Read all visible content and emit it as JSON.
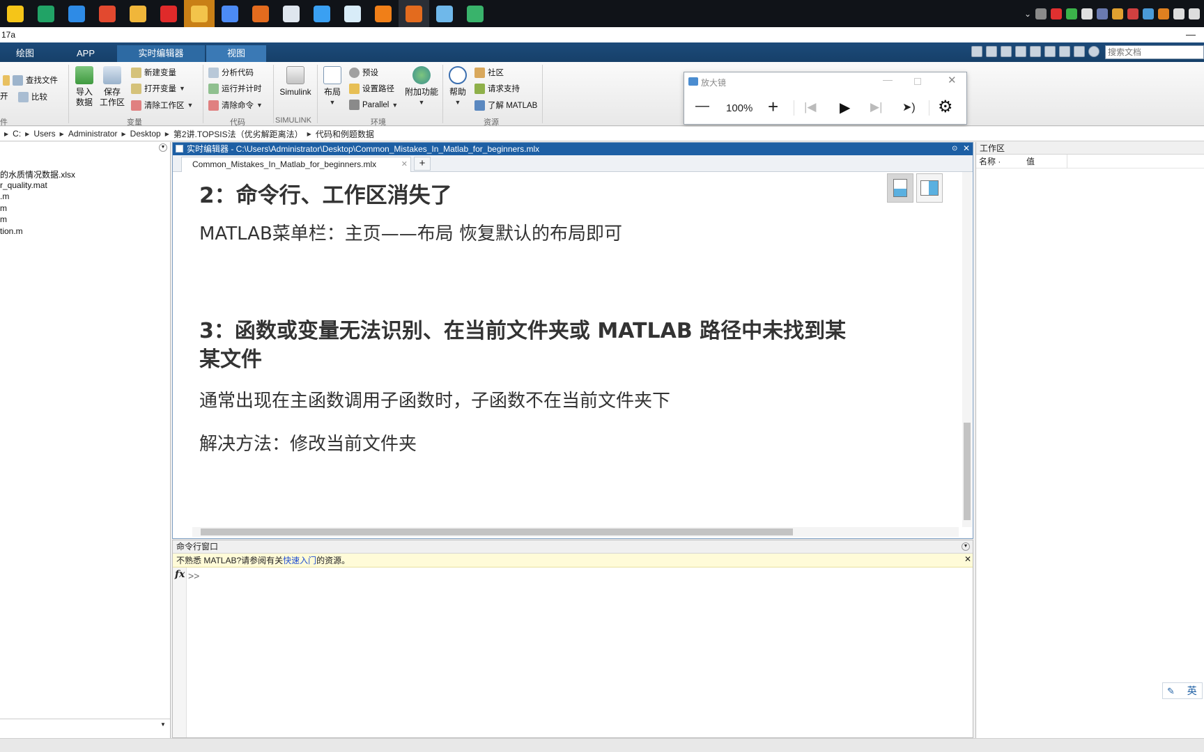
{
  "taskbar": {
    "apps": [
      {
        "name": "sticky-notes-app-icon",
        "color": "#f5c518",
        "state": ""
      },
      {
        "name": "excel-app-icon",
        "color": "#21a366",
        "state": ""
      },
      {
        "name": "sogou-app-icon",
        "color": "#2e8be6",
        "state": ""
      },
      {
        "name": "listen-app-icon",
        "color": "#e2492f",
        "state": ""
      },
      {
        "name": "file-explorer-app-icon",
        "color": "#f0b63a",
        "state": ""
      },
      {
        "name": "netease-music-app-icon",
        "color": "#e02a2a",
        "state": ""
      },
      {
        "name": "folder-app-icon",
        "color": "#f3c44b",
        "state": "active"
      },
      {
        "name": "chrome-app-icon",
        "color": "#4c8bf5",
        "state": ""
      },
      {
        "name": "matlab-app-icon",
        "color": "#e36b1e",
        "state": ""
      },
      {
        "name": "document-app-icon",
        "color": "#dfe6ee",
        "state": ""
      },
      {
        "name": "baidu-netdisk-app-icon",
        "color": "#3aa0f2",
        "state": ""
      },
      {
        "name": "pdf-viewer-app-icon",
        "color": "#d8ecf8",
        "state": ""
      },
      {
        "name": "search-app-icon",
        "color": "#f07f18",
        "state": ""
      },
      {
        "name": "matlab-running-app-icon",
        "color": "#e36b1e",
        "state": "dim"
      },
      {
        "name": "remote-desktop-app-icon",
        "color": "#6fb8ea",
        "state": ""
      },
      {
        "name": "screen-tool-app-icon",
        "color": "#39b36b",
        "state": ""
      }
    ],
    "tray": [
      "#8a8a8a",
      "#e03030",
      "#3bb34a",
      "#e0e0e0",
      "#6a7ab0",
      "#e0a030",
      "#d04040",
      "#4a9ad8",
      "#e08020",
      "#dddddd",
      "#dddddd"
    ]
  },
  "window": {
    "title": "17a",
    "minimize_glyph": "—"
  },
  "ribbon_tabs": [
    {
      "label": "绘图",
      "style": "normal"
    },
    {
      "label": "APP",
      "style": "normal"
    },
    {
      "label": "实时编辑器",
      "style": "selected"
    },
    {
      "label": "视图",
      "style": "hl"
    }
  ],
  "search_docs_placeholder": "搜索文档",
  "ribbon": {
    "file_group": {
      "find_files": "查找文件",
      "open": "开",
      "compare": "比较",
      "label": "件"
    },
    "import_data": "导入\n数据",
    "save_workspace": "保存\n工作区",
    "variable_group": {
      "new_variable": "新建变量",
      "open_variable": "打开变量",
      "clear_workspace": "清除工作区",
      "label": "变量"
    },
    "code_group": {
      "analyze_code": "分析代码",
      "run_and_time": "运行并计时",
      "clear_commands": "清除命令",
      "label": "代码"
    },
    "simulink": "Simulink",
    "simulink_label": "SIMULINK",
    "layout": "布局",
    "env_group": {
      "preferences": "预设",
      "set_path": "设置路径",
      "parallel": "Parallel",
      "label": "环境"
    },
    "addons": "附加功能",
    "help": "帮助",
    "resources_group": {
      "community": "社区",
      "request_support": "请求支持",
      "learn_matlab": "了解 MATLAB",
      "label": "资源"
    }
  },
  "magnifier": {
    "title": "放大镜",
    "zoom": "100%",
    "minus": "—",
    "plus": "+"
  },
  "address": {
    "crumbs": [
      "C:",
      "Users",
      "Administrator",
      "Desktop",
      "第2讲.TOPSIS法（优劣解距离法）",
      "代码和例题数据"
    ]
  },
  "files": [
    "的水质情况数据.xlsx",
    "r_quality.mat",
    ".m",
    "m",
    "m",
    "tion.m"
  ],
  "editor": {
    "title": "实时编辑器 - C:\\Users\\Administrator\\Desktop\\Common_Mistakes_In_Matlab_for_beginners.mlx",
    "tab": "Common_Mistakes_In_Matlab_for_beginners.mlx",
    "tab_close": "✕",
    "add_tab": "+",
    "heading2": "2：命令行、工作区消失了",
    "para1": "MATLAB菜单栏：主页——布局  恢复默认的布局即可",
    "heading3_line1": "3：函数或变量无法识别、在当前文件夹或 MATLAB 路径中未找到某",
    "heading3_line2": "某文件",
    "para2": "通常出现在主函数调用子函数时，子函数不在当前文件夹下",
    "para3": "解决方法：修改当前文件夹"
  },
  "command_window": {
    "header": "命令行窗口",
    "banner_prefix": "不熟悉 MATLAB?请参阅有关",
    "banner_link": "快速入门",
    "banner_suffix": "的资源。",
    "prompt": ">>"
  },
  "workspace": {
    "header": "工作区",
    "col_name": "名称 ·",
    "col_value": "值"
  },
  "ime": {
    "label": "英"
  }
}
